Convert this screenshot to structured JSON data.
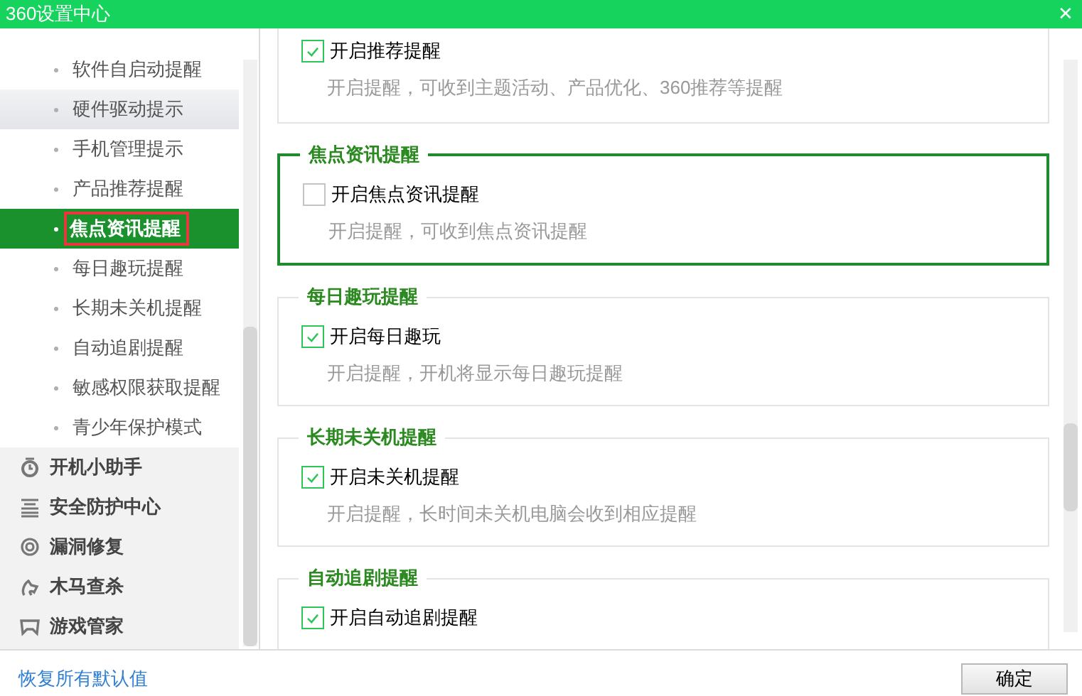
{
  "window": {
    "title": "360设置中心",
    "close": "✕"
  },
  "sidebar": {
    "sub_items": [
      {
        "label": "软件自启动提醒",
        "selected": false,
        "hovered": false,
        "outlined": false
      },
      {
        "label": "硬件驱动提示",
        "selected": false,
        "hovered": true,
        "outlined": false
      },
      {
        "label": "手机管理提示",
        "selected": false,
        "hovered": false,
        "outlined": false
      },
      {
        "label": "产品推荐提醒",
        "selected": false,
        "hovered": false,
        "outlined": false
      },
      {
        "label": "焦点资讯提醒",
        "selected": true,
        "hovered": false,
        "outlined": true
      },
      {
        "label": "每日趣玩提醒",
        "selected": false,
        "hovered": false,
        "outlined": false
      },
      {
        "label": "长期未关机提醒",
        "selected": false,
        "hovered": false,
        "outlined": false
      },
      {
        "label": "自动追剧提醒",
        "selected": false,
        "hovered": false,
        "outlined": false
      },
      {
        "label": "敏感权限获取提醒",
        "selected": false,
        "hovered": false,
        "outlined": false
      },
      {
        "label": "青少年保护模式",
        "selected": false,
        "hovered": false,
        "outlined": false
      }
    ],
    "groups": [
      {
        "label": "开机小助手"
      },
      {
        "label": "安全防护中心"
      },
      {
        "label": "漏洞修复"
      },
      {
        "label": "木马查杀"
      },
      {
        "label": "游戏管家"
      }
    ]
  },
  "sections": [
    {
      "option": "开启推荐提醒",
      "checked": true,
      "description": "开启提醒，可收到主题活动、产品优化、360推荐等提醒",
      "highlighted": false
    },
    {
      "title": "焦点资讯提醒",
      "option": "开启焦点资讯提醒",
      "checked": false,
      "description": "开启提醒，可收到焦点资讯提醒",
      "highlighted": true
    },
    {
      "title": "每日趣玩提醒",
      "option": "开启每日趣玩",
      "checked": true,
      "description": "开启提醒，开机将显示每日趣玩提醒",
      "highlighted": false
    },
    {
      "title": "长期未关机提醒",
      "option": "开启未关机提醒",
      "checked": true,
      "description": "开启提醒，长时间未关机电脑会收到相应提醒",
      "highlighted": false
    },
    {
      "title": "自动追剧提醒",
      "option": "开启自动追剧提醒",
      "checked": true,
      "highlighted": false
    }
  ],
  "footer": {
    "reset_link": "恢复所有默认值",
    "ok_button": "确定"
  }
}
